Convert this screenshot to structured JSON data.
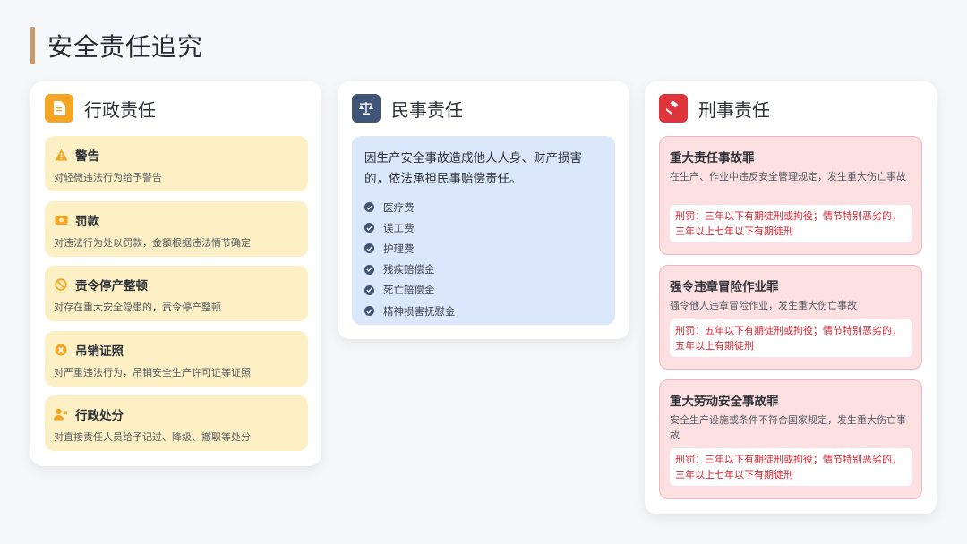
{
  "title": "安全责任追究",
  "colors": {
    "accent_bar": "#c89a6b",
    "admin": "#f4a524",
    "civil": "#3f5476",
    "criminal": "#e0343c"
  },
  "admin": {
    "title": "行政责任",
    "icon": "document-icon",
    "items": [
      {
        "icon": "warning-icon",
        "name": "警告",
        "desc": "对轻微违法行为给予警告"
      },
      {
        "icon": "money-icon",
        "name": "罚款",
        "desc": "对违法行为处以罚款，金额根据违法情节确定"
      },
      {
        "icon": "ban-icon",
        "name": "责令停产整顿",
        "desc": "对存在重大安全隐患的，责令停产整顿"
      },
      {
        "icon": "cancel-circle-icon",
        "name": "吊销证照",
        "desc": "对严重违法行为，吊销安全生产许可证等证照"
      },
      {
        "icon": "user-remove-icon",
        "name": "行政处分",
        "desc": "对直接责任人员给予记过、降级、撤职等处分"
      }
    ]
  },
  "civil": {
    "title": "民事责任",
    "icon": "scale-icon",
    "text": "因生产安全事故造成他人人身、财产损害的，依法承担民事赔偿责任。",
    "list": [
      "医疗费",
      "误工费",
      "护理费",
      "残疾赔偿金",
      "死亡赔偿金",
      "精神损害抚慰金"
    ]
  },
  "criminal": {
    "title": "刑事责任",
    "icon": "gavel-icon",
    "items": [
      {
        "name": "重大责任事故罪",
        "desc": "在生产、作业中违反安全管理规定，发生重大伤亡事故",
        "penalty": "刑罚：三年以下有期徒刑或拘役；情节特别恶劣的，三年以上七年以下有期徒刑"
      },
      {
        "name": "强令违章冒险作业罪",
        "desc": "强令他人违章冒险作业，发生重大伤亡事故",
        "penalty": "刑罚：五年以下有期徒刑或拘役；情节特别恶劣的，五年以上有期徒刑"
      },
      {
        "name": "重大劳动安全事故罪",
        "desc": "安全生产设施或条件不符合国家规定，发生重大伤亡事故",
        "penalty": "刑罚：三年以下有期徒刑或拘役；情节特别恶劣的，三年以上七年以下有期徒刑"
      }
    ]
  }
}
